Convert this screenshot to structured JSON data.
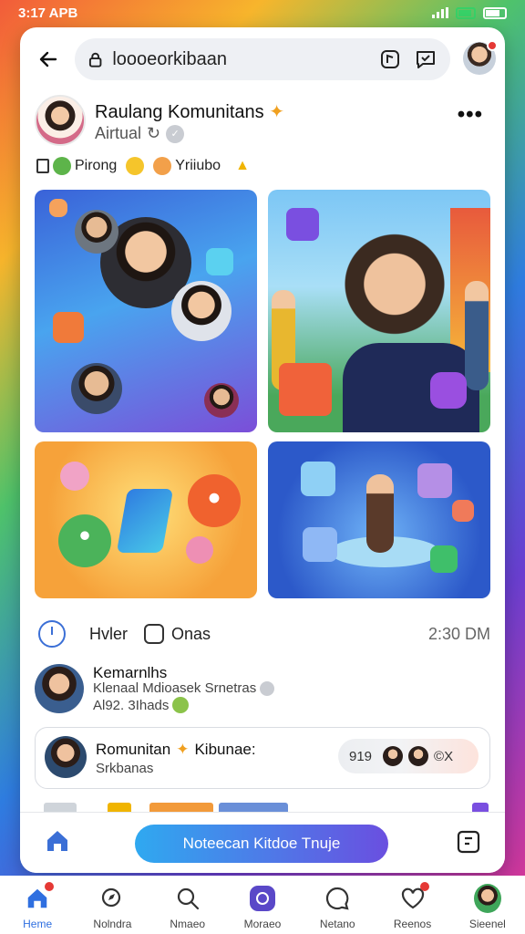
{
  "status_bar": {
    "time": "3:17 APB"
  },
  "browser": {
    "search_value": "loooeorkibaan",
    "back_icon": "arrow-left-icon",
    "lock_icon": "lock-icon",
    "icons": [
      "sticker-icon",
      "message-check-icon"
    ]
  },
  "post": {
    "title": "Raulang Komunitans",
    "subtitle": "Airtual",
    "more_label": "•••",
    "tags_text_1": "Pirong",
    "tags_text_2": "Yriiubo"
  },
  "meta": {
    "action_1": "Hvler",
    "action_2": "Onas",
    "time": "2:30 DM"
  },
  "comments": [
    {
      "name": "Kemarnlhs",
      "text": "Klenaal Mdioasek Srnetras",
      "meta": "Al92. 3Ihads"
    },
    {
      "name": "Romunitan",
      "name_suffix": "Kibunae:",
      "meta": "Srkbanas",
      "reaction_count": "919",
      "reaction_extra": "©X"
    }
  ],
  "cta": {
    "label": "Noteecan Kitdoe Tnuje"
  },
  "bottom_nav": [
    {
      "label": "Heme",
      "icon": "home-icon",
      "active": true,
      "dot": true
    },
    {
      "label": "Nolndra",
      "icon": "explore-icon",
      "active": false,
      "dot": false
    },
    {
      "label": "Nmaeo",
      "icon": "search-icon",
      "active": false,
      "dot": false
    },
    {
      "label": "Moraeo",
      "icon": "create-icon",
      "active": false,
      "dot": false
    },
    {
      "label": "Netano",
      "icon": "chat-icon",
      "active": false,
      "dot": false
    },
    {
      "label": "Reenos",
      "icon": "heart-icon",
      "active": false,
      "dot": true
    },
    {
      "label": "Sieenel",
      "icon": "profile-avatar-icon",
      "active": false,
      "dot": false
    }
  ],
  "colors": {
    "accent": "#2f6fe0",
    "cta_start": "#2fa9f0",
    "cta_end": "#6a4fe0",
    "notification": "#e53935"
  }
}
